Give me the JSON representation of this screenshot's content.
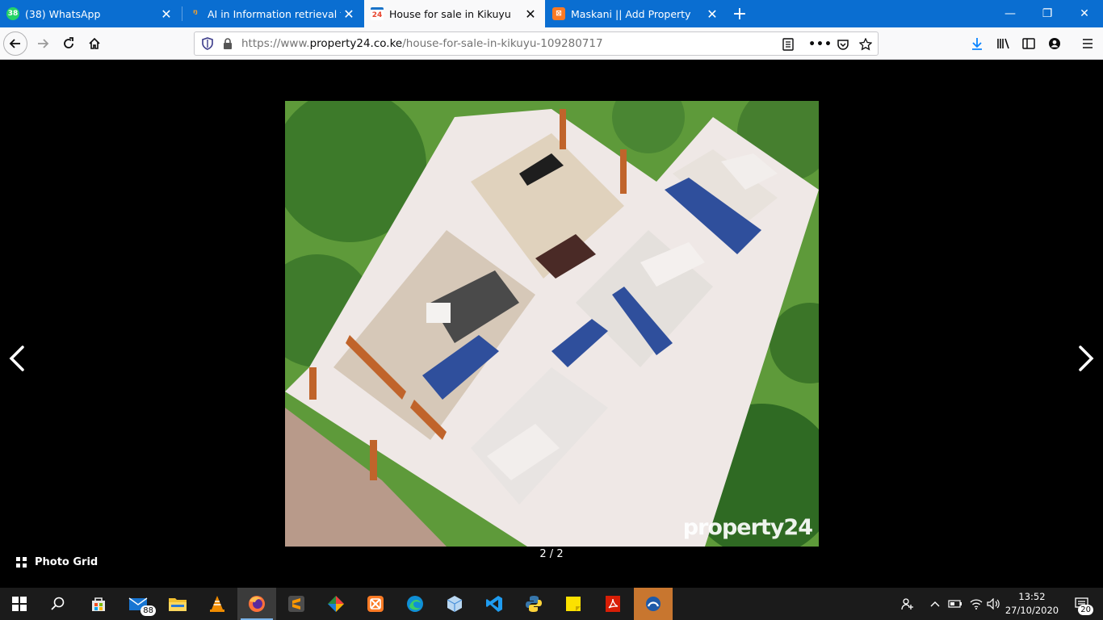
{
  "browser": {
    "tabs": [
      {
        "title": "(38) WhatsApp",
        "favicon": "whatsapp-icon",
        "badge": "38",
        "active": false
      },
      {
        "title": "AI in Information retrieval for M",
        "favicon": "researchgate-icon",
        "active": false
      },
      {
        "title": "House for sale in Kikuyu",
        "favicon": "property24-icon",
        "badge": "24",
        "active": true
      },
      {
        "title": "Maskani || Add Property",
        "favicon": "xampp-icon",
        "active": false
      }
    ],
    "url": {
      "prefix": "https://www.",
      "domain": "property24.co.ke",
      "path": "/house-for-sale-in-kikuyu-109280717"
    }
  },
  "gallery": {
    "counter": "2 / 2",
    "photo_grid_label": "Photo Grid",
    "watermark": "property24"
  },
  "taskbar": {
    "mail_badge": "88",
    "clock_time": "13:52",
    "clock_date": "27/10/2020",
    "notifications": "20"
  },
  "colors": {
    "tabbar": "#0a6ed1",
    "accent_download": "#0a84ff"
  }
}
